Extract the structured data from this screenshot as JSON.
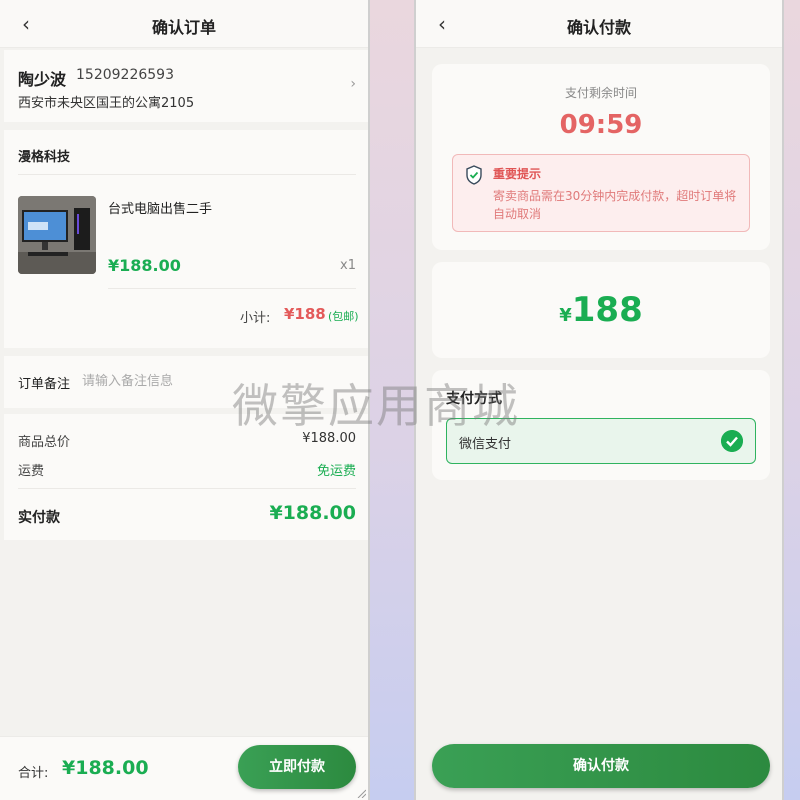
{
  "left": {
    "nav": {
      "back_icon": "chevron-left-icon",
      "title": "确认订单"
    },
    "address": {
      "name": "陶少波",
      "phone": "15209226593",
      "detail": "西安市未央区国王的公寓2105"
    },
    "shop": {
      "name": "漫格科技",
      "product": {
        "title": "台式电脑出售二手",
        "price": "¥188.00",
        "qty": "x1"
      },
      "subtotal_label": "小计:",
      "subtotal_value": "¥188",
      "shipping_tag": "(包邮)"
    },
    "remark": {
      "label": "订单备注",
      "placeholder": "请输入备注信息"
    },
    "totals": {
      "goods_total_label": "商品总价",
      "goods_total_value": "¥188.00",
      "freight_label": "运费",
      "freight_value": "免运费",
      "paid_label": "实付款",
      "paid_value": "¥188.00"
    },
    "footer": {
      "total_label": "合计:",
      "total_value": "¥188.00",
      "pay_button": "立即付款"
    }
  },
  "right": {
    "nav": {
      "back_icon": "chevron-left-icon",
      "title": "确认付款"
    },
    "timer": {
      "label": "支付剩余时间",
      "value": "09:59"
    },
    "notice": {
      "title": "重要提示",
      "text": "寄卖商品需在30分钟内完成付款，超时订单将自动取消"
    },
    "amount": {
      "symbol": "¥",
      "value": "188"
    },
    "payment_method": {
      "title": "支付方式",
      "selected": "微信支付"
    },
    "confirm_button": "确认付款"
  },
  "watermark": "微擎应用商城",
  "colors": {
    "accent_green": "#1aad52",
    "timer_red": "#e46464",
    "notice_bg": "#fdeeee"
  }
}
